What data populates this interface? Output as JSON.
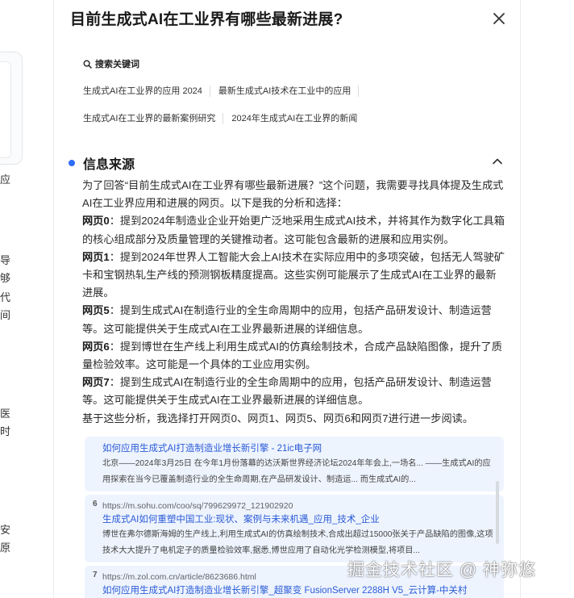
{
  "background": {
    "left_fragments": [
      "应",
      "导",
      "够",
      "代",
      "间",
      "医",
      "时",
      "安",
      "原"
    ]
  },
  "panel": {
    "title": "目前生成式AI在工业界有哪些最新进展?",
    "search_keywords": {
      "heading": "搜索关键词",
      "rows": [
        [
          "生成式AI在工业界的应用 2024",
          "最新生成式AI技术在工业中的应用"
        ],
        [
          "生成式AI在工业界的最新案例研究",
          "2024年生成式AI在工业界的新闻"
        ]
      ]
    },
    "source_section": {
      "heading": "信息来源",
      "intro": "为了回答“目前生成式AI在工业界有哪些最新进展？”这个问题，我需要寻找具体提及生成式AI在工业界应用和进展的网页。以下是我的分析和选择：",
      "items": [
        {
          "label": "网页0",
          "text": "：提到2024年制造业企业开始更广泛地采用生成式AI技术，并将其作为数字化工具箱的核心组成部分及质量管理的关键推动者。这可能包含最新的进展和应用实例。"
        },
        {
          "label": "网页1",
          "text": "：提到2024年世界人工智能大会上AI技术在实际应用中的多项突破，包括无人驾驶矿卡和宝钢热轧生产线的预测钢板精度提高。这些实例可能展示了生成式AI在工业界的最新进展。"
        },
        {
          "label": "网页5",
          "text": "：提到生成式AI在制造行业的全生命周期中的应用，包括产品研发设计、制造运营等。这可能提供关于生成式AI在工业界最新进展的详细信息。"
        },
        {
          "label": "网页6",
          "text": "：提到博世在生产线上利用生成式AI的仿真绘制技术，合成产品缺陷图像，提升了质量检验效率。这可能是一个具体的工业应用实例。"
        },
        {
          "label": "网页7",
          "text": "：提到生成式AI在制造行业的全生命周期中的应用，包括产品研发设计、制造运营等。这可能提供关于生成式AI在工业界最新进展的详细信息。"
        }
      ],
      "conclusion": "基于这些分析，我选择打开网页0、网页1、网页5、网页6和网页7进行进一步阅读。"
    },
    "references": [
      {
        "num": "",
        "url": "",
        "title": "如何应用生成式AI打造制造业增长新引擎 - 21ic电子网",
        "snippet": "北京——2024年3月25日 在今年1月份落幕的达沃斯世界经济论坛2024年年会上,一场名... ——生成式AI的应用探索在当今已覆盖制造行业的全生命周期,在产品研发设计、制造运... 而生成式AI的..."
      },
      {
        "num": "6",
        "url": "https://m.sohu.com/coo/sq/799629972_121902920",
        "title": "生成式AI如何重塑中国工业:现状、案例与未来机遇_应用_技术_企业",
        "snippet": "博世在弗尔德斯海姆的生产线上,利用生成式AI的仿真绘制技术,合成出超过15000张关于产品缺陷的图像,这项技术大大提升了电机定子的质量检验效率,据悉,博世应用了自动化光学检测模型,将项目..."
      },
      {
        "num": "7",
        "url": "https://m.zol.com.cn/article/8623686.html",
        "title": "如何应用生成式AI打造制造业增长新引擎_超聚变 FusionServer 2288H V5_云计算-中关村",
        "snippet": ""
      }
    ]
  },
  "watermark": "掘金技术社区 @ 神弥悠",
  "colors": {
    "accent": "#2f6df6",
    "link": "#2b5bd7",
    "ref_bg": "#eef4fe"
  }
}
